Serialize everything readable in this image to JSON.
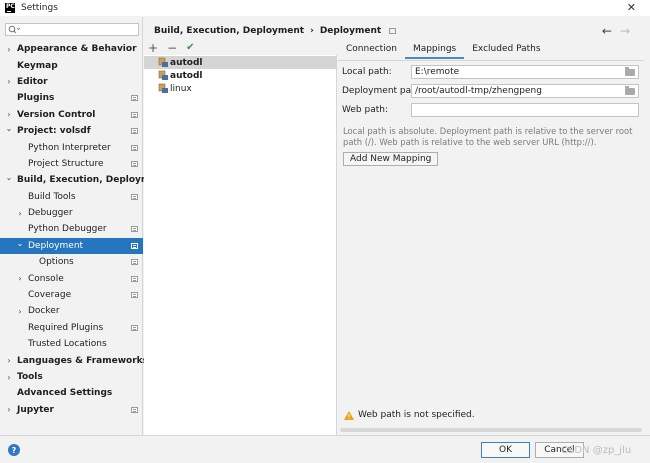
{
  "window": {
    "title": "Settings",
    "app_icon_text": "PC"
  },
  "sidebar": {
    "search_placeholder": "",
    "items": [
      {
        "label": "Appearance & Behavior",
        "level": 0,
        "bold": true,
        "chevron": "right",
        "project_icon": false
      },
      {
        "label": "Keymap",
        "level": 0,
        "bold": true,
        "chevron": "",
        "project_icon": false
      },
      {
        "label": "Editor",
        "level": 0,
        "bold": true,
        "chevron": "right",
        "project_icon": false
      },
      {
        "label": "Plugins",
        "level": 0,
        "bold": true,
        "chevron": "",
        "project_icon": true
      },
      {
        "label": "Version Control",
        "level": 0,
        "bold": true,
        "chevron": "right",
        "project_icon": true
      },
      {
        "label": "Project: volsdf",
        "level": 0,
        "bold": true,
        "chevron": "down",
        "project_icon": true
      },
      {
        "label": "Python Interpreter",
        "level": 1,
        "bold": false,
        "chevron": "",
        "project_icon": true
      },
      {
        "label": "Project Structure",
        "level": 1,
        "bold": false,
        "chevron": "",
        "project_icon": true
      },
      {
        "label": "Build, Execution, Deployment",
        "level": 0,
        "bold": true,
        "chevron": "down",
        "project_icon": false
      },
      {
        "label": "Build Tools",
        "level": 1,
        "bold": false,
        "chevron": "",
        "project_icon": true
      },
      {
        "label": "Debugger",
        "level": 1,
        "bold": false,
        "chevron": "right",
        "project_icon": false
      },
      {
        "label": "Python Debugger",
        "level": 1,
        "bold": false,
        "chevron": "",
        "project_icon": true
      },
      {
        "label": "Deployment",
        "level": 1,
        "bold": false,
        "chevron": "down",
        "project_icon": true,
        "selected": true
      },
      {
        "label": "Options",
        "level": 2,
        "bold": false,
        "chevron": "",
        "project_icon": true
      },
      {
        "label": "Console",
        "level": 1,
        "bold": false,
        "chevron": "right",
        "project_icon": true
      },
      {
        "label": "Coverage",
        "level": 1,
        "bold": false,
        "chevron": "",
        "project_icon": true
      },
      {
        "label": "Docker",
        "level": 1,
        "bold": false,
        "chevron": "right",
        "project_icon": false
      },
      {
        "label": "Required Plugins",
        "level": 1,
        "bold": false,
        "chevron": "",
        "project_icon": true
      },
      {
        "label": "Trusted Locations",
        "level": 1,
        "bold": false,
        "chevron": "",
        "project_icon": false
      },
      {
        "label": "Languages & Frameworks",
        "level": 0,
        "bold": true,
        "chevron": "right",
        "project_icon": false
      },
      {
        "label": "Tools",
        "level": 0,
        "bold": true,
        "chevron": "right",
        "project_icon": false
      },
      {
        "label": "Advanced Settings",
        "level": 0,
        "bold": true,
        "chevron": "",
        "project_icon": false
      },
      {
        "label": "Jupyter",
        "level": 0,
        "bold": true,
        "chevron": "right",
        "project_icon": true
      }
    ]
  },
  "breadcrumb": {
    "parent": "Build, Execution, Deployment",
    "separator": "›",
    "current": "Deployment"
  },
  "server_list": {
    "toolbar": {
      "add": "+",
      "remove": "−",
      "default": "✔"
    },
    "servers": [
      {
        "name": "autodl",
        "bold": true,
        "selected": true
      },
      {
        "name": "autodl",
        "bold": true,
        "selected": false
      },
      {
        "name": "linux",
        "bold": false,
        "selected": false
      }
    ]
  },
  "tabs": [
    {
      "label": "Connection",
      "active": false
    },
    {
      "label": "Mappings",
      "active": true
    },
    {
      "label": "Excluded Paths",
      "active": false
    }
  ],
  "mappings": {
    "local_path_label": "Local path:",
    "local_path_value": "E:\\remote",
    "deployment_path_label": "Deployment path:",
    "deployment_path_value": "/root/autodl-tmp/zhengpeng",
    "web_path_label": "Web path:",
    "web_path_value": "",
    "help_text": "Local path is absolute. Deployment path is relative to the server root path (/). Web path is relative to the web server URL (http://).",
    "add_mapping_label": "Add New Mapping",
    "warning": "Web path is not specified."
  },
  "footer": {
    "help": "?",
    "ok_label": "OK",
    "cancel_label": "Cancel",
    "watermark": "CSDN @zp_jlu"
  },
  "colors": {
    "selection": "#2675bf",
    "accent": "#4a88c7",
    "warning": "#e6a21a"
  }
}
